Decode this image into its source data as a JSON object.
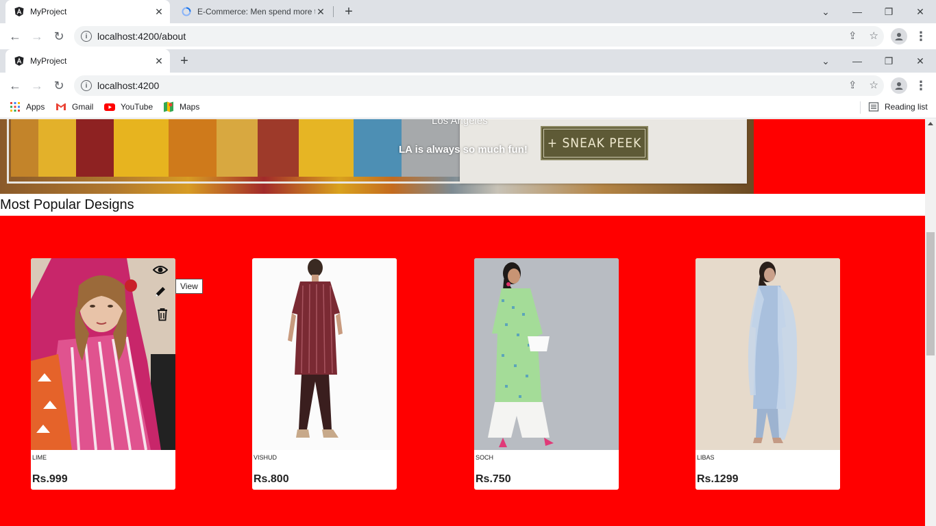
{
  "window_back": {
    "tabs": [
      {
        "title": "MyProject",
        "active": true
      },
      {
        "title": "E-Commerce: Men spend more th",
        "active": false
      }
    ],
    "url": "localhost:4200/about"
  },
  "window_front": {
    "tabs": [
      {
        "title": "MyProject",
        "active": true
      }
    ],
    "url": "localhost:4200"
  },
  "bookmarks": {
    "items": [
      {
        "label": "Apps",
        "icon": "apps-grid-icon"
      },
      {
        "label": "Gmail",
        "icon": "gmail-icon"
      },
      {
        "label": "YouTube",
        "icon": "youtube-icon"
      },
      {
        "label": "Maps",
        "icon": "maps-icon"
      }
    ],
    "reading_list": "Reading list"
  },
  "banner": {
    "city": "Los Angeles",
    "tagline": "LA is always so much fun!",
    "cta": "+ SNEAK PEEK",
    "side_color": "#ff0000"
  },
  "section": {
    "title": "Most Popular Designs",
    "background": "#ff0000"
  },
  "products": [
    {
      "brand": "LIME",
      "price": "Rs.999"
    },
    {
      "brand": "VISHUD",
      "price": "Rs.800"
    },
    {
      "brand": "SOCH",
      "price": "Rs.750"
    },
    {
      "brand": "LIBAS",
      "price": "Rs.1299"
    }
  ],
  "card_actions": {
    "view_icon": "eye-icon",
    "edit_icon": "pencil-icon",
    "delete_icon": "trash-icon",
    "tooltip": "View"
  }
}
